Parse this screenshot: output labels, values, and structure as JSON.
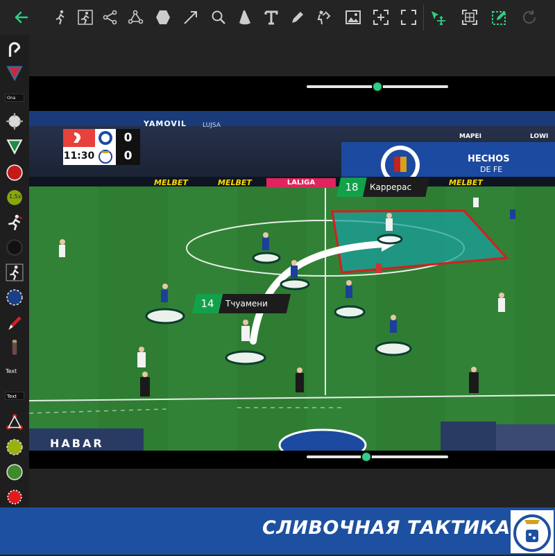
{
  "toolbar": {
    "back": "back-arrow",
    "tools": [
      "player-move",
      "player-run",
      "pass-network",
      "connect-lines",
      "polygon-zone",
      "arrow",
      "magnifier",
      "spotlight",
      "text",
      "pen",
      "player-cutout",
      "image",
      "zoom-frame",
      "crop-frame",
      "move-select",
      "grid",
      "edit-box",
      "undo"
    ]
  },
  "sidebar": {
    "tag_one": "Ona",
    "badge_speed": "1.5x",
    "text_plain": "Text",
    "text_tag": "Text"
  },
  "scoreboard": {
    "time": "11:30",
    "home_score": "0",
    "away_score": "0"
  },
  "ads": {
    "board": "YAMOVIL",
    "sponsor_1": "MELBET",
    "sponsor_2": "MELBET",
    "sponsor_3": "MELBET",
    "league": "LALIGA",
    "stand_1": "HECHOS",
    "stand_2": "DE FE",
    "brand_1": "MAPEI",
    "brand_2": "LOWI",
    "brand_3": "LUJSA",
    "bench": "HABAR"
  },
  "players": {
    "p1_number": "18",
    "p1_name": "Каррерас",
    "p2_number": "14",
    "p2_name": "Тчуамени"
  },
  "footer": {
    "title": "СЛИВОЧНАЯ ТАКТИКА"
  },
  "colors": {
    "accent": "#2fcf85",
    "zone_fill": "#1aa0a0",
    "zone_border": "#d81d1d",
    "footer_bg": "#1d50a0"
  }
}
